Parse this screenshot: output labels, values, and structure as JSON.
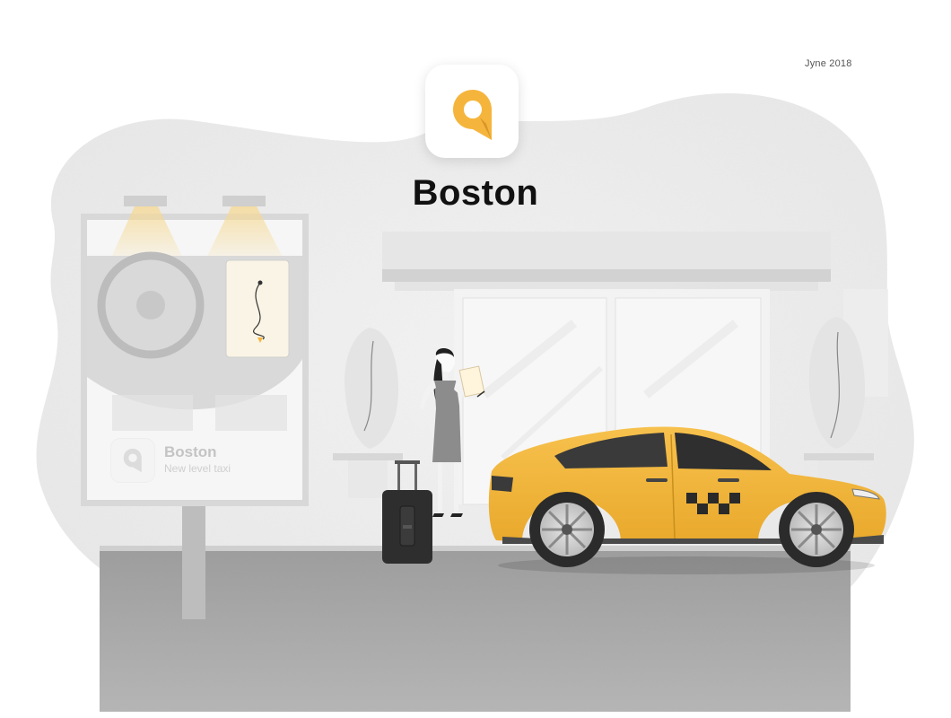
{
  "header": {
    "date": "Jyne 2018",
    "app_name": "Boston",
    "logo_icon": "map-pin-logo"
  },
  "billboard": {
    "brand": "Boston",
    "tagline": "New level taxi",
    "logo_icon": "map-pin-logo"
  },
  "colors": {
    "accent": "#F5B53C",
    "taxi_yellow": "#F2B43A",
    "background_blob": "#EEEEEE",
    "sidewalk": "#A8A8A8"
  }
}
